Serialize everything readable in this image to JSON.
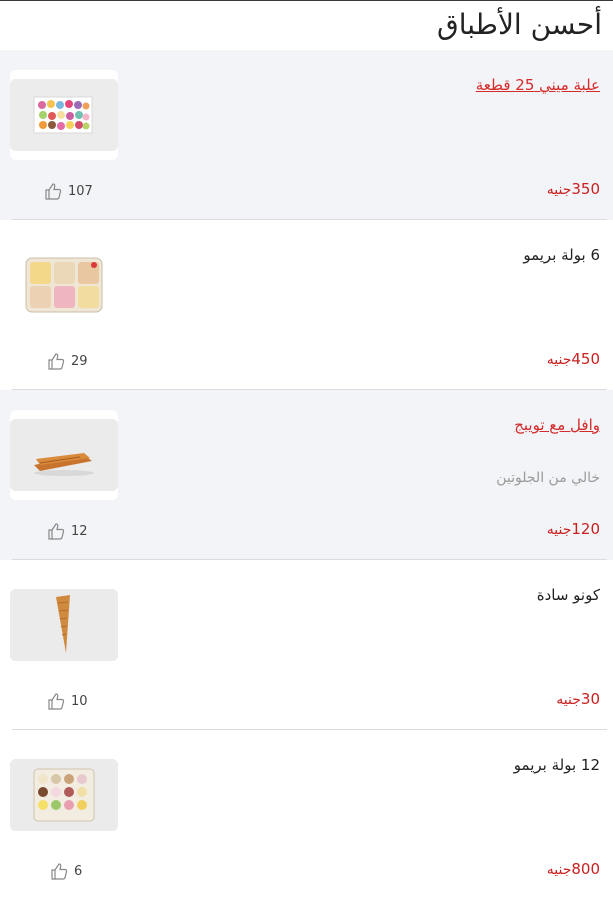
{
  "page": {
    "title": "أحسن الأطباق"
  },
  "currency": "جنيه",
  "colors": {
    "accent": "#c8211f",
    "shaded_bg": "#f2f4f7"
  },
  "items": [
    {
      "name": "علبة ميني 25 قطعة",
      "desc": "",
      "price": "350",
      "likes": "107",
      "link": true,
      "shaded": true,
      "image": "macarons-box"
    },
    {
      "name": "6 بولة بريمو",
      "desc": "",
      "price": "450",
      "likes": "29",
      "link": false,
      "shaded": false,
      "image": "gelato-6-box"
    },
    {
      "name": "وافل مع تويبج",
      "desc": "خالي من الجلوتين",
      "price": "120",
      "likes": "12",
      "link": true,
      "shaded": true,
      "image": "waffle"
    },
    {
      "name": "كونو سادة",
      "desc": "",
      "price": "30",
      "likes": "10",
      "link": false,
      "shaded": false,
      "image": "cone"
    },
    {
      "name": "12 بولة بريمو",
      "desc": "",
      "price": "800",
      "likes": "6",
      "link": false,
      "shaded": false,
      "image": "gelato-12-box"
    }
  ]
}
